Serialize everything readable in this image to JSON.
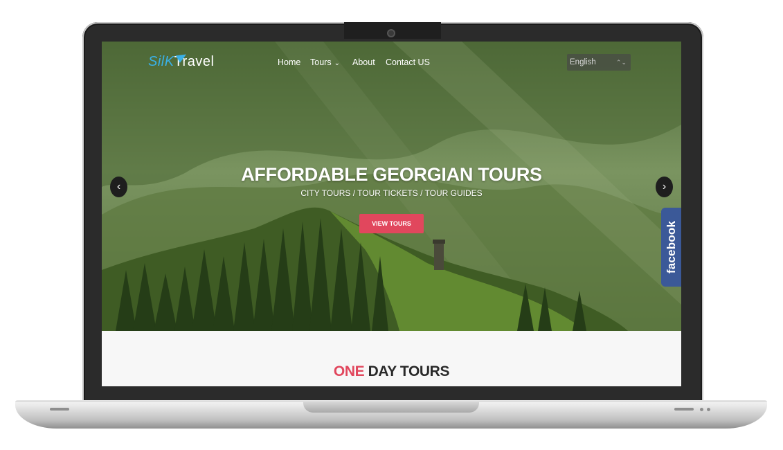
{
  "header": {
    "logo": {
      "part1": "SilK",
      "part2": "Travel"
    },
    "nav": [
      {
        "label": "Home"
      },
      {
        "label": "Tours",
        "caret": "⌄"
      },
      {
        "label": "About"
      },
      {
        "label": "Contact US"
      }
    ],
    "language": {
      "selected": "English",
      "arrows": "⌃⌄"
    }
  },
  "hero": {
    "title": "AFFORDABLE GEORGIAN TOURS",
    "subtitle": "CITY TOURS / TOUR TICKETS / TOUR GUIDES",
    "cta_label": "VIEW TOURS",
    "prev_icon": "‹",
    "next_icon": "›"
  },
  "facebook_tab": {
    "label": "facebook"
  },
  "section": {
    "title_accent": "ONE",
    "title_rest": " DAY TOURS"
  },
  "colors": {
    "accent": "#e1475d",
    "logo_blue": "#3ab0e6",
    "facebook": "#3b5998"
  }
}
